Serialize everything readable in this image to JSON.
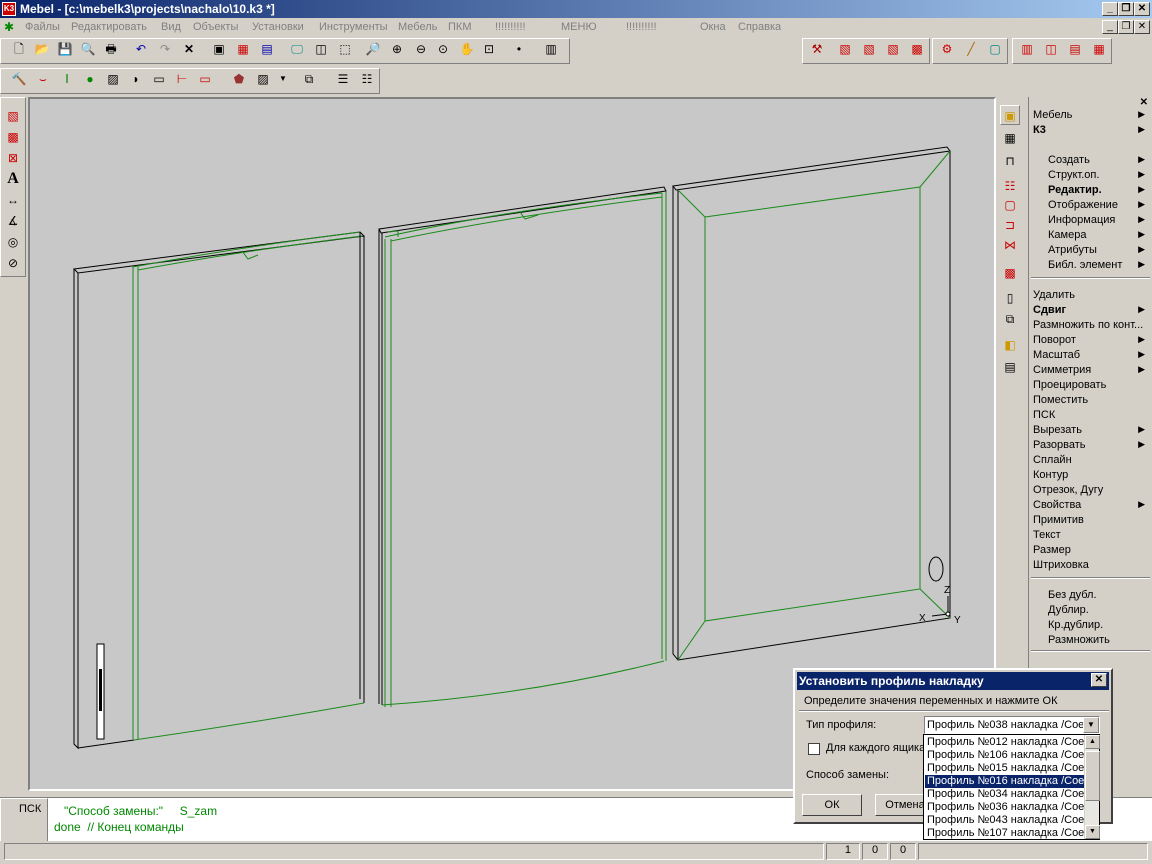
{
  "window": {
    "title": "Mebel - [c:\\mebelk3\\projects\\nachalo\\10.k3 *]",
    "app_icon": "K3"
  },
  "menu": {
    "items": [
      "Файлы",
      "Редактировать",
      "Вид",
      "Объекты",
      "Установки",
      "Инструменты",
      "Мебель",
      "ПКМ",
      "!!!!!!!!!!",
      "МЕНЮ",
      "!!!!!!!!!!",
      "Окна",
      "Справка"
    ]
  },
  "right_panel": {
    "items": [
      {
        "label": "Мебель",
        "arrow": true,
        "bold": false,
        "indent": false
      },
      {
        "label": "К3",
        "arrow": true,
        "bold": true,
        "indent": false
      },
      {
        "label": "Создать",
        "arrow": true,
        "bold": false,
        "indent": true
      },
      {
        "label": "Структ.оп.",
        "arrow": true,
        "bold": false,
        "indent": true
      },
      {
        "label": "Редактир.",
        "arrow": true,
        "bold": true,
        "indent": true
      },
      {
        "label": "Отображение",
        "arrow": true,
        "bold": false,
        "indent": true
      },
      {
        "label": "Информация",
        "arrow": true,
        "bold": false,
        "indent": true
      },
      {
        "label": "Камера",
        "arrow": true,
        "bold": false,
        "indent": true
      },
      {
        "label": "Атрибуты",
        "arrow": true,
        "bold": false,
        "indent": true
      },
      {
        "label": "Библ. элемент",
        "arrow": true,
        "bold": false,
        "indent": true
      },
      {
        "label": "Удалить",
        "arrow": false,
        "bold": false,
        "indent": false
      },
      {
        "label": "Сдвиг",
        "arrow": true,
        "bold": true,
        "indent": false
      },
      {
        "label": "Размножить по конт...",
        "arrow": false,
        "bold": false,
        "indent": false
      },
      {
        "label": "Поворот",
        "arrow": true,
        "bold": false,
        "indent": false
      },
      {
        "label": "Масштаб",
        "arrow": true,
        "bold": false,
        "indent": false
      },
      {
        "label": "Симметрия",
        "arrow": true,
        "bold": false,
        "indent": false
      },
      {
        "label": "Проецировать",
        "arrow": false,
        "bold": false,
        "indent": false
      },
      {
        "label": "Поместить",
        "arrow": false,
        "bold": false,
        "indent": false
      },
      {
        "label": "ПСК",
        "arrow": false,
        "bold": false,
        "indent": false
      },
      {
        "label": "Вырезать",
        "arrow": true,
        "bold": false,
        "indent": false
      },
      {
        "label": "Разорвать",
        "arrow": true,
        "bold": false,
        "indent": false
      },
      {
        "label": "Сплайн",
        "arrow": false,
        "bold": false,
        "indent": false
      },
      {
        "label": "Контур",
        "arrow": false,
        "bold": false,
        "indent": false
      },
      {
        "label": "Отрезок, Дугу",
        "arrow": false,
        "bold": false,
        "indent": false
      },
      {
        "label": "Свойства",
        "arrow": true,
        "bold": false,
        "indent": false
      },
      {
        "label": "Примитив",
        "arrow": false,
        "bold": false,
        "indent": false
      },
      {
        "label": "Текст",
        "arrow": false,
        "bold": false,
        "indent": false
      },
      {
        "label": "Размер",
        "arrow": false,
        "bold": false,
        "indent": false
      },
      {
        "label": "Штриховка",
        "arrow": false,
        "bold": false,
        "indent": false
      },
      {
        "label": "Без дубл.",
        "arrow": false,
        "bold": false,
        "indent": true
      },
      {
        "label": "Дублир.",
        "arrow": false,
        "bold": false,
        "indent": true
      },
      {
        "label": "Кр.дублир.",
        "arrow": false,
        "bold": false,
        "indent": true
      },
      {
        "label": "Размножить",
        "arrow": false,
        "bold": false,
        "indent": true
      }
    ]
  },
  "command": {
    "ucs_label": "ПСК",
    "line1": "\"Способ замены:\"     S_zam",
    "line2": "done  // Конец команды"
  },
  "status": {
    "a": "1",
    "b": "0",
    "c": "0"
  },
  "axes": {
    "x": "X",
    "y": "Y",
    "z": "Z"
  },
  "dialog": {
    "title": "Установить профиль накладку",
    "prompt": "Определите значения переменных и нажмите ОК",
    "profile_type_label": "Тип профиля:",
    "profile_value": "Профиль №038 накладка /Сое",
    "each_box_label": "Для каждого ящика",
    "each_box_checked": false,
    "replace_label": "Способ замены:",
    "ok": "ОК",
    "cancel": "Отмена"
  },
  "dropdown": {
    "options": [
      "Профиль №012 накладка /Сое",
      "Профиль №106 накладка /Сое",
      "Профиль №015 накладка /Сое",
      "Профиль №016 накладка /Сое",
      "Профиль №034 накладка /Сое",
      "Профиль №036 накладка /Сое",
      "Профиль №043 накладка /Сое",
      "Профиль №107 накладка /Сое"
    ],
    "selected_index": 3
  },
  "colors": {
    "edge_green": "#1a8a1a",
    "titlebar": "#0a246a",
    "canvas": "#c8c8c8"
  }
}
